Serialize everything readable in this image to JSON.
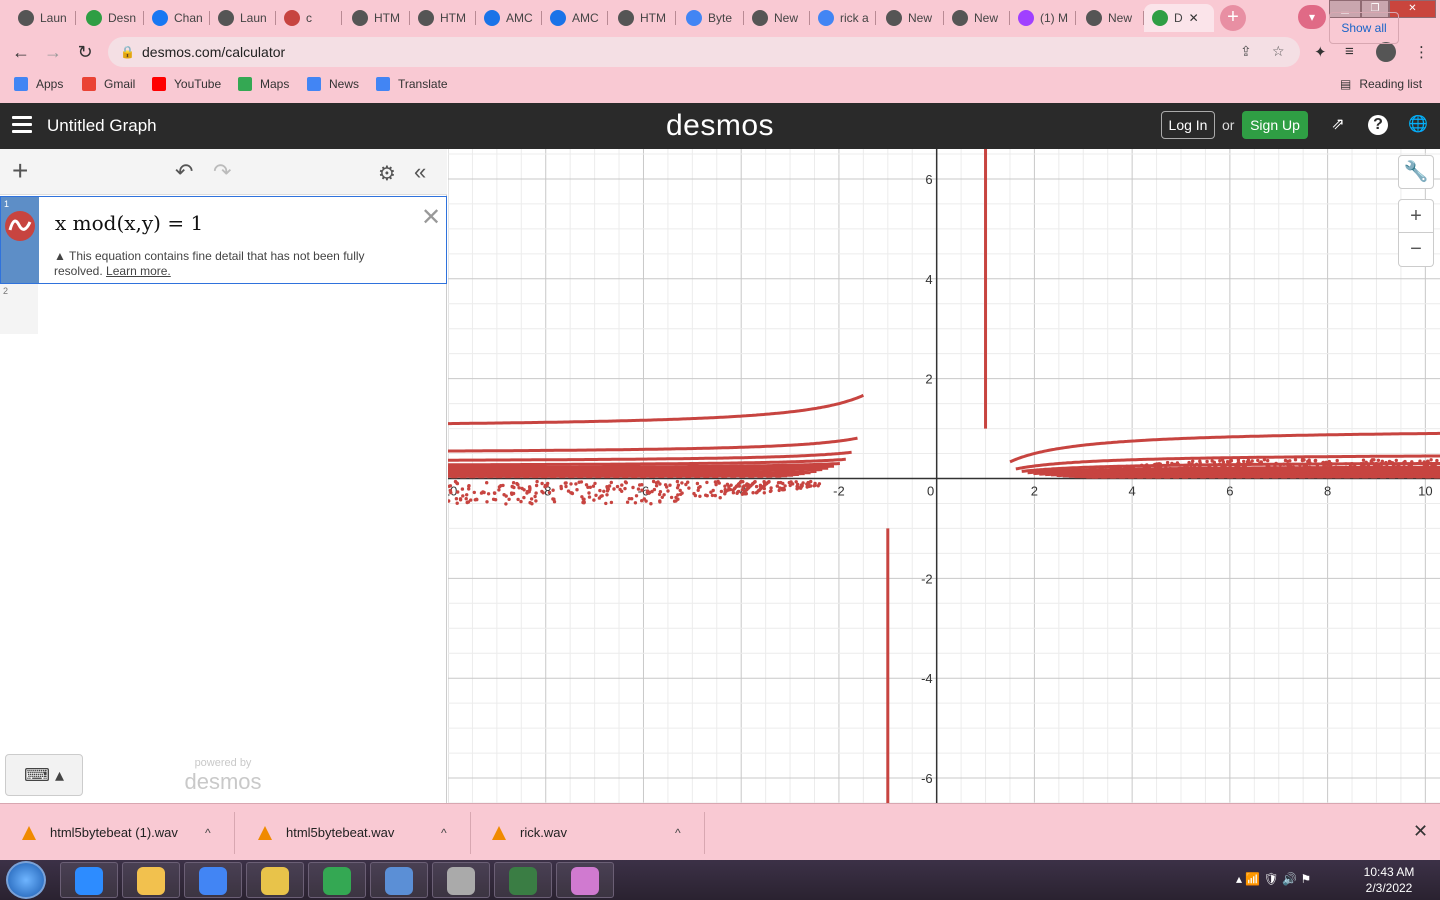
{
  "browser": {
    "tabs": [
      {
        "label": "Laun",
        "icon": "chrome-icon",
        "color": "#555555"
      },
      {
        "label": "Desn",
        "icon": "desmos-icon",
        "color": "#2f9e44"
      },
      {
        "label": "Chan",
        "icon": "facebook-icon",
        "color": "#1877f2"
      },
      {
        "label": "Laun",
        "icon": "chrome-icon",
        "color": "#555555"
      },
      {
        "label": "c",
        "icon": "audio-icon",
        "color": "#c74440"
      },
      {
        "label": "HTM",
        "icon": "chrome-icon",
        "color": "#555555"
      },
      {
        "label": "HTM",
        "icon": "chrome-icon",
        "color": "#555555"
      },
      {
        "label": "AMC",
        "icon": "wn-icon",
        "color": "#1a73e8"
      },
      {
        "label": "AMC",
        "icon": "wn-icon",
        "color": "#1a73e8"
      },
      {
        "label": "HTM",
        "icon": "chrome-icon",
        "color": "#555555"
      },
      {
        "label": "Byte",
        "icon": "google-icon",
        "color": "#4285f4"
      },
      {
        "label": "New",
        "icon": "chrome-icon",
        "color": "#555555"
      },
      {
        "label": "rick a",
        "icon": "google-icon",
        "color": "#4285f4"
      },
      {
        "label": "New",
        "icon": "chrome-icon",
        "color": "#555555"
      },
      {
        "label": "New",
        "icon": "chrome-icon",
        "color": "#555555"
      },
      {
        "label": "(1) M",
        "icon": "messenger-icon",
        "color": "#a040ff"
      },
      {
        "label": "New",
        "icon": "chrome-icon",
        "color": "#555555"
      },
      {
        "label": "D",
        "icon": "desmos-icon",
        "color": "#2f9e44",
        "active": true
      }
    ],
    "url": "desmos.com/calculator",
    "bookmarks": [
      {
        "label": "Apps",
        "icon": "apps-grid-icon",
        "color": "#4285f4"
      },
      {
        "label": "Gmail",
        "icon": "gmail-icon",
        "color": "#ea4335"
      },
      {
        "label": "YouTube",
        "icon": "youtube-icon",
        "color": "#ff0000"
      },
      {
        "label": "Maps",
        "icon": "maps-icon",
        "color": "#34a853"
      },
      {
        "label": "News",
        "icon": "news-icon",
        "color": "#4285f4"
      },
      {
        "label": "Translate",
        "icon": "translate-icon",
        "color": "#4285f4"
      }
    ],
    "reading_list": "Reading list"
  },
  "desmos": {
    "graph_title": "Untitled Graph",
    "logo": "desmos",
    "login": "Log In",
    "or": "or",
    "signup": "Sign Up",
    "expressions": [
      {
        "index": "1",
        "latex_text": "x mod(x,y) = 1",
        "warning": "This equation contains fine detail that has not been fully resolved.",
        "learn_more": "Learn more.",
        "color": "#c74440"
      },
      {
        "index": "2"
      }
    ],
    "powered_by": "powered by",
    "powered_logo": "desmos",
    "curve_color": "#c74440"
  },
  "chart_data": {
    "type": "scatter",
    "title": "",
    "expression": "x mod(x,y) = 1",
    "xlim": [
      -10,
      10.3
    ],
    "ylim": [
      -6.5,
      6.6
    ],
    "x_ticks": [
      "-10",
      "-8",
      "-6",
      "-4",
      "-2",
      "0",
      "2",
      "4",
      "6",
      "8",
      "10"
    ],
    "y_ticks": [
      "6",
      "4",
      "2",
      "-2",
      "-4",
      "-6"
    ],
    "grid": true,
    "series": [
      {
        "name": "x mod(x,y) = 1",
        "color": "#c74440",
        "description": "curve family x = 1 + k*x*y for integer k"
      }
    ]
  },
  "downloads": [
    {
      "label": "html5bytebeat (1).wav"
    },
    {
      "label": "html5bytebeat.wav"
    },
    {
      "label": "rick.wav"
    }
  ],
  "show_all": "Show all",
  "taskbar": {
    "time": "10:43 AM",
    "date": "2/3/2022",
    "apps": [
      "zoom-icon",
      "file-explorer-icon",
      "chrome-icon",
      "folder-icon",
      "chrome-profile-icon",
      "control-panel-icon",
      "media-player-icon",
      "task-manager-icon",
      "paint-icon"
    ]
  }
}
